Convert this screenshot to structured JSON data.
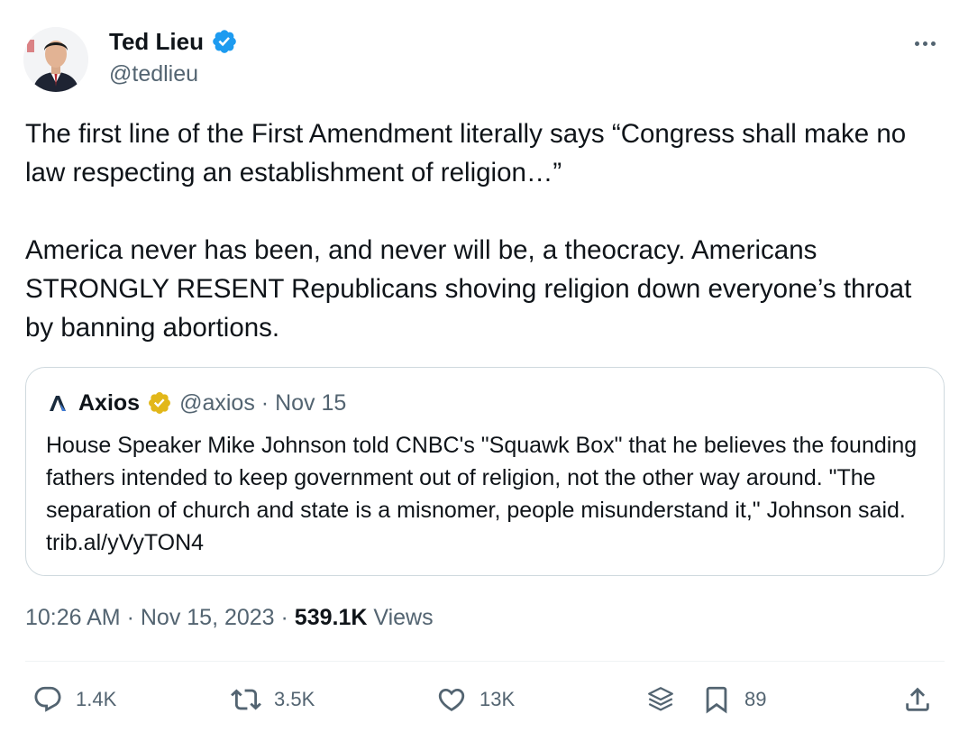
{
  "author": {
    "name": "Ted Lieu",
    "handle": "@tedlieu",
    "verified_color": "#1d9bf0"
  },
  "tweet": {
    "paragraph1": "The first line of the First Amendment literally says “Congress shall make no law respecting an establishment of religion…”",
    "paragraph2": "America never has been, and never will be, a theocracy. Americans STRONGLY RESENT Republicans shoving religion down everyone’s throat by banning abortions."
  },
  "quote": {
    "name": "Axios",
    "handle": "@axios",
    "separator": " · ",
    "date": "Nov 15",
    "badge_color": "#e2b719",
    "text": "House Speaker Mike Johnson told CNBC's \"Squawk Box\" that he believes the founding fathers intended to keep government out of religion, not the other way around. \"The separation of church and state is a misnomer, people misunderstand it,\" Johnson said. trib.al/yVyTON4"
  },
  "meta": {
    "time": "10:26 AM",
    "date": "Nov 15, 2023",
    "views_count": "539.1K",
    "views_label": "Views"
  },
  "actions": {
    "reply_count": "1.4K",
    "retweet_count": "3.5K",
    "like_count": "13K",
    "bookmark_count": "89"
  },
  "icons": {
    "avatar": "avatar-photo",
    "verified": "verified-badge-icon",
    "more": "more-icon",
    "axios_logo": "axios-logo-icon",
    "gold_badge": "gold-verified-badge-icon",
    "reply": "reply-icon",
    "retweet": "retweet-icon",
    "like": "heart-icon",
    "analytics": "analytics-icon",
    "bookmark": "bookmark-icon",
    "share": "share-icon"
  }
}
